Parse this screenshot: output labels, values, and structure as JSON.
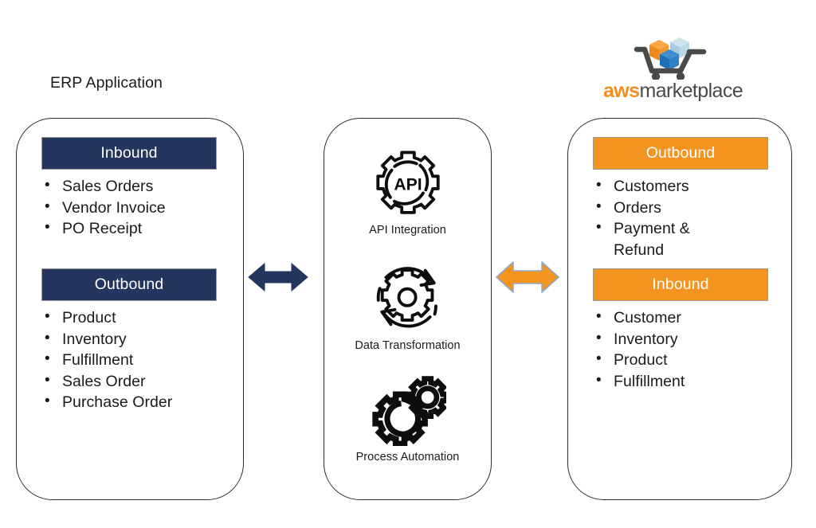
{
  "diagram": {
    "title_left": "ERP Application",
    "left_panel": {
      "sections": [
        {
          "header": "Inbound",
          "items": [
            "Sales Orders",
            "Vendor Invoice",
            "PO Receipt"
          ]
        },
        {
          "header": "Outbound",
          "items": [
            "Product",
            "Inventory",
            "Fulfillment",
            "Sales Order",
            "Purchase Order"
          ]
        }
      ]
    },
    "middle_panel": {
      "capabilities": [
        {
          "icon": "api-gear-icon",
          "label": "API Integration"
        },
        {
          "icon": "data-transformation-icon",
          "label": "Data Transformation"
        },
        {
          "icon": "process-automation-icon",
          "label": "Process Automation"
        }
      ],
      "api_icon_text": "API"
    },
    "right_panel": {
      "logo": {
        "icon": "aws-marketplace-cart-icon",
        "word_aws": "aws",
        "word_marketplace": "marketplace"
      },
      "sections": [
        {
          "header": "Outbound",
          "items": [
            "Customers",
            "Orders",
            "Payment & Refund"
          ]
        },
        {
          "header": "Inbound",
          "items": [
            "Customer",
            "Inventory",
            "Product",
            "Fulfillment"
          ]
        }
      ]
    },
    "connectors": [
      {
        "name": "erp-to-middle-arrow",
        "direction": "bidirectional",
        "color": "#24365e"
      },
      {
        "name": "middle-to-aws-arrow",
        "direction": "bidirectional",
        "color": "#f2941f"
      }
    ],
    "colors": {
      "navy": "#24365e",
      "orange": "#f2941f",
      "logo_orange": "#f28f1c",
      "logo_gray": "#4a4a4a",
      "box_outline": "#2b2b2b",
      "header_border": "#9a9a9a"
    }
  }
}
